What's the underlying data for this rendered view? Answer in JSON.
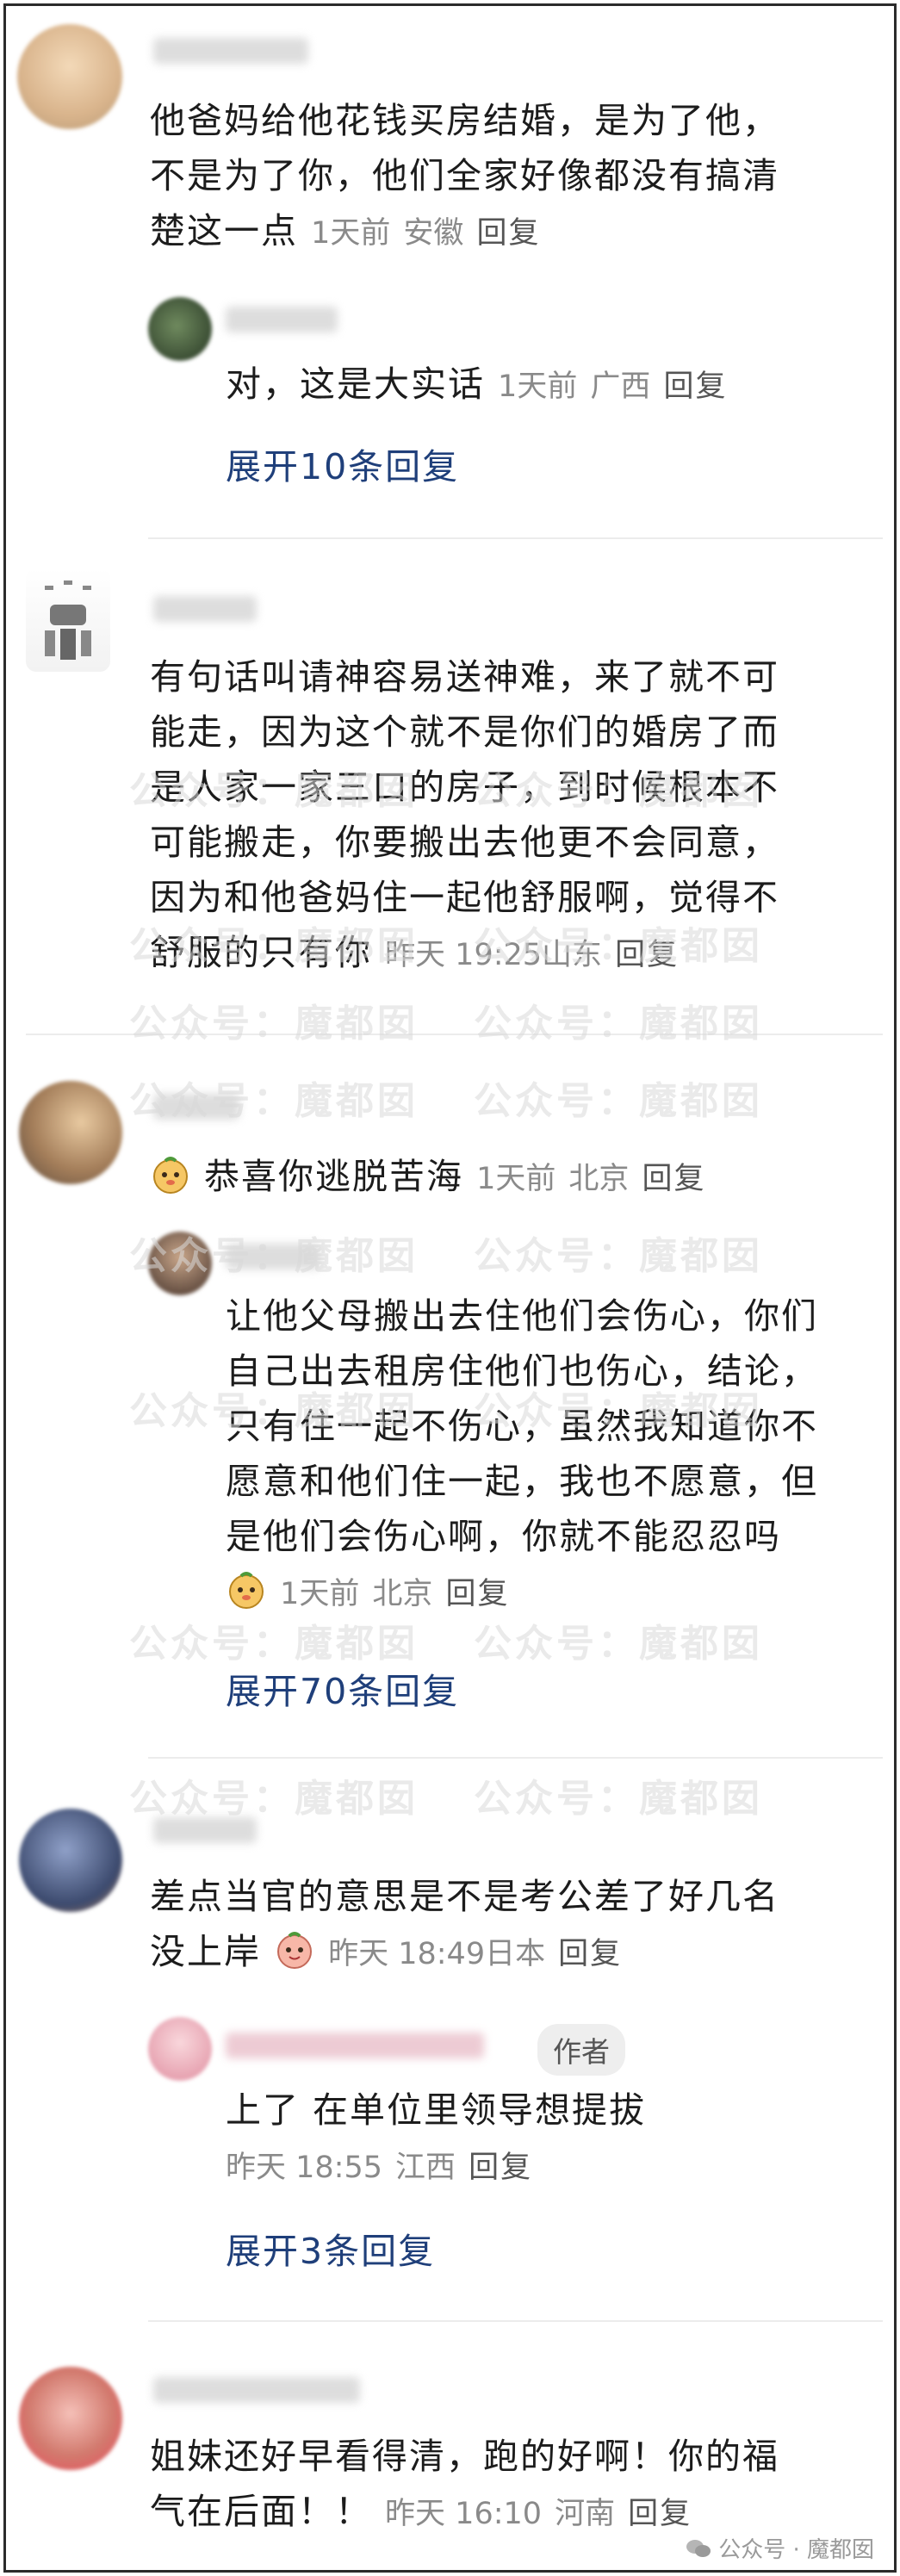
{
  "comments": [
    {
      "text_lines": [
        "他爸妈给他花钱买房结婚，是为了他，",
        "不是为了你，他们全家好像都没有搞清",
        "楚这一点"
      ],
      "time": "1天前",
      "location": "安徽",
      "reply_label": "回复",
      "replies": [
        {
          "text": "对，这是大实话",
          "time": "1天前",
          "location": "广西",
          "reply_label": "回复"
        }
      ],
      "expand_label": "展开10条回复"
    },
    {
      "text_lines": [
        "有句话叫请神容易送神难，来了就不可",
        "能走，因为这个就不是你们的婚房了而",
        "是人家一家三口的房子，到时候根本不",
        "可能搬走，你要搬出去他更不会同意，",
        "因为和他爸妈住一起他舒服啊，觉得不",
        "舒服的只有你"
      ],
      "time": "昨天 19:25",
      "location": "山东",
      "reply_label": "回复"
    },
    {
      "text": "恭喜你逃脱苦海",
      "time": "1天前",
      "location": "北京",
      "reply_label": "回复",
      "replies": [
        {
          "text_lines": [
            "让他父母搬出去住他们会伤心，你们",
            "自己出去租房住他们也伤心，结论，",
            "只有住一起不伤心，虽然我知道你不",
            "愿意和他们住一起，我也不愿意，但",
            "是他们会伤心啊，你就不能忍忍吗"
          ],
          "time": "1天前",
          "location": "北京",
          "reply_label": "回复"
        }
      ],
      "expand_label": "展开70条回复"
    },
    {
      "text_lines": [
        "差点当官的意思是不是考公差了好几名",
        "没上岸"
      ],
      "time": "昨天 18:49",
      "location": "日本",
      "reply_label": "回复",
      "replies": [
        {
          "text": "上了 在单位里领导想提拔",
          "author_tag": "作者",
          "time": "昨天 18:55",
          "location": "江西",
          "reply_label": "回复"
        }
      ],
      "expand_label": "展开3条回复"
    },
    {
      "text_lines": [
        "姐妹还好早看得清，跑的好啊！你的福",
        "气在后面！！"
      ],
      "time": "昨天 16:10",
      "location": "河南",
      "reply_label": "回复"
    }
  ],
  "watermark": "公众号：魔都囡",
  "footer_watermark": "公众号 · 魔都囡",
  "colors": {
    "link": "#1f3f7a",
    "meta": "#8a8a8a",
    "divider": "#ececec"
  }
}
